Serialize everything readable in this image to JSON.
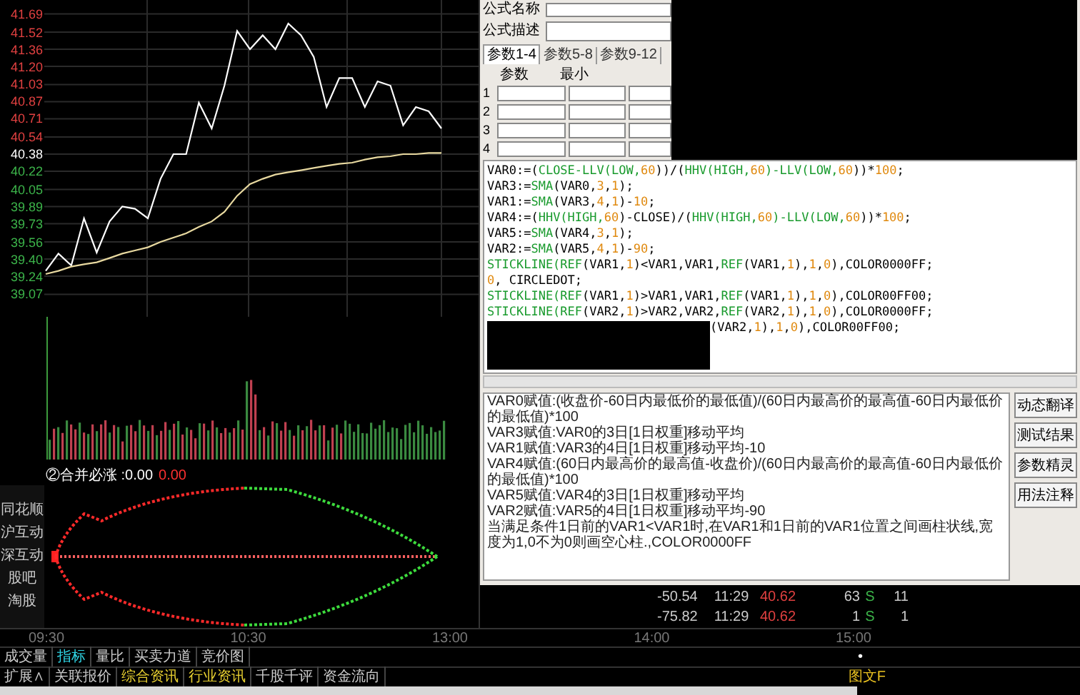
{
  "price_chart": {
    "chart_data": {
      "type": "line",
      "grid": true,
      "series": [
        {
          "color": "#ffffff",
          "values": [
            39.29,
            39.45,
            39.34,
            39.78,
            39.46,
            39.75,
            39.89,
            39.87,
            39.78,
            40.15,
            40.38,
            40.38,
            40.86,
            40.62,
            41.02,
            41.53,
            41.36,
            41.49,
            41.36,
            41.6,
            41.49,
            41.29,
            40.82,
            41.09,
            41.09,
            40.82,
            41.06,
            41.02,
            40.65,
            40.82,
            40.78,
            40.62
          ]
        },
        {
          "color": "#e8d9a0",
          "values": [
            39.26,
            39.29,
            39.33,
            39.35,
            39.37,
            39.41,
            39.45,
            39.48,
            39.51,
            39.56,
            39.6,
            39.64,
            39.7,
            39.75,
            39.84,
            39.99,
            40.1,
            40.15,
            40.19,
            40.21,
            40.23,
            40.25,
            40.27,
            40.29,
            40.3,
            40.33,
            40.35,
            40.36,
            40.38,
            40.38,
            40.39,
            40.39
          ]
        }
      ],
      "ylim": [
        38.86,
        41.82
      ],
      "yticks": [
        {
          "value": 41.69,
          "label": "41.69"
        },
        {
          "value": 41.52,
          "label": "41.52"
        },
        {
          "value": 41.36,
          "label": "41.36"
        },
        {
          "value": 41.2,
          "label": "41.20"
        },
        {
          "value": 41.03,
          "label": "41.03"
        },
        {
          "value": 40.87,
          "label": "40.87"
        },
        {
          "value": 40.71,
          "label": "40.71"
        },
        {
          "value": 40.54,
          "label": "40.54"
        },
        {
          "value": 40.38,
          "label": "40.38"
        },
        {
          "value": 40.22,
          "label": "40.22"
        },
        {
          "value": 40.05,
          "label": "40.05"
        },
        {
          "value": 39.89,
          "label": "39.89"
        },
        {
          "value": 39.73,
          "label": "39.73"
        },
        {
          "value": 39.56,
          "label": "39.56"
        },
        {
          "value": 39.4,
          "label": "39.40"
        },
        {
          "value": 39.24,
          "label": "39.24"
        },
        {
          "value": 39.07,
          "label": "39.07"
        }
      ]
    }
  },
  "indicator": {
    "title": "②合并必涨 :0.00",
    "value": "0.00"
  },
  "side_links": [
    "同花顺",
    "沪互动",
    "深互动",
    "股吧",
    "淘股"
  ],
  "time_axis": [
    "09:30",
    "10:30",
    "13:00",
    "14:00",
    "15:00"
  ],
  "chart_tabs": [
    {
      "label": "成交量",
      "selected": false
    },
    {
      "label": "指标",
      "selected": true
    },
    {
      "label": "量比",
      "selected": false
    },
    {
      "label": "买卖力道",
      "selected": false
    },
    {
      "label": "竞价图",
      "selected": false
    }
  ],
  "info_tabs": [
    {
      "label": "扩展∧",
      "highlighted": false
    },
    {
      "label": "关联报价",
      "highlighted": false
    },
    {
      "label": "综合资讯",
      "highlighted": true
    },
    {
      "label": "行业资讯",
      "highlighted": true
    },
    {
      "label": "千股千评",
      "highlighted": false
    },
    {
      "label": "资金流向",
      "highlighted": false
    }
  ],
  "side_mark": "•",
  "side_tab": "图文F",
  "quote_rows": [
    {
      "change": "-50.54",
      "time": "11:29",
      "price": "40.62",
      "volume": "63",
      "side": "S",
      "count": "11"
    },
    {
      "change": "-75.82",
      "time": "11:29",
      "price": "40.62",
      "volume": "1",
      "side": "S",
      "count": "1"
    }
  ],
  "dialog": {
    "name_label": "公式名称",
    "desc_label": "公式描述",
    "param_tabs": [
      {
        "label": "参数1-4",
        "selected": true
      },
      {
        "label": "参数5-8",
        "selected": false
      },
      {
        "label": "参数9-12",
        "selected": false
      }
    ],
    "param_headers": [
      "参数",
      "最小"
    ],
    "param_rows": [
      "1",
      "2",
      "3",
      "4"
    ],
    "code_lines": [
      [
        {
          "text": "VAR0:=(",
          "kind": "plain"
        },
        {
          "text": "CLOSE-LLV(LOW,",
          "kind": "fn"
        },
        {
          "text": "60",
          "kind": "num"
        },
        {
          "text": "))/(",
          "kind": "plain"
        },
        {
          "text": "HHV(HIGH,",
          "kind": "fn"
        },
        {
          "text": "60",
          "kind": "num"
        },
        {
          "text": ")-LLV(LOW,",
          "kind": "fn"
        },
        {
          "text": "60",
          "kind": "num"
        },
        {
          "text": "))*",
          "kind": "plain"
        },
        {
          "text": "100",
          "kind": "num"
        },
        {
          "text": ";",
          "kind": "plain"
        }
      ],
      [
        {
          "text": "VAR3:=",
          "kind": "plain"
        },
        {
          "text": "SMA",
          "kind": "fn"
        },
        {
          "text": "(VAR0,",
          "kind": "plain"
        },
        {
          "text": "3",
          "kind": "num"
        },
        {
          "text": ",",
          "kind": "plain"
        },
        {
          "text": "1",
          "kind": "num"
        },
        {
          "text": ");",
          "kind": "plain"
        }
      ],
      [
        {
          "text": "VAR1:=",
          "kind": "plain"
        },
        {
          "text": "SMA",
          "kind": "fn"
        },
        {
          "text": "(VAR3,",
          "kind": "plain"
        },
        {
          "text": "4",
          "kind": "num"
        },
        {
          "text": ",",
          "kind": "plain"
        },
        {
          "text": "1",
          "kind": "num"
        },
        {
          "text": ")-",
          "kind": "plain"
        },
        {
          "text": "10",
          "kind": "num"
        },
        {
          "text": ";",
          "kind": "plain"
        }
      ],
      [
        {
          "text": "VAR4:=(",
          "kind": "plain"
        },
        {
          "text": "HHV(HIGH,",
          "kind": "fn"
        },
        {
          "text": "60",
          "kind": "num"
        },
        {
          "text": ")-CLOSE)/(",
          "kind": "plain"
        },
        {
          "text": "HHV(HIGH,",
          "kind": "fn"
        },
        {
          "text": "60",
          "kind": "num"
        },
        {
          "text": ")-LLV(LOW,",
          "kind": "fn"
        },
        {
          "text": "60",
          "kind": "num"
        },
        {
          "text": "))*",
          "kind": "plain"
        },
        {
          "text": "100",
          "kind": "num"
        },
        {
          "text": ";",
          "kind": "plain"
        }
      ],
      [
        {
          "text": "VAR5:=",
          "kind": "plain"
        },
        {
          "text": "SMA",
          "kind": "fn"
        },
        {
          "text": "(VAR4,",
          "kind": "plain"
        },
        {
          "text": "3",
          "kind": "num"
        },
        {
          "text": ",",
          "kind": "plain"
        },
        {
          "text": "1",
          "kind": "num"
        },
        {
          "text": ");",
          "kind": "plain"
        }
      ],
      [
        {
          "text": "VAR2:=",
          "kind": "plain"
        },
        {
          "text": "SMA",
          "kind": "fn"
        },
        {
          "text": "(VAR5,",
          "kind": "plain"
        },
        {
          "text": "4",
          "kind": "num"
        },
        {
          "text": ",",
          "kind": "plain"
        },
        {
          "text": "1",
          "kind": "num"
        },
        {
          "text": ")-",
          "kind": "plain"
        },
        {
          "text": "90",
          "kind": "num"
        },
        {
          "text": ";",
          "kind": "plain"
        }
      ],
      [
        {
          "text": "STICKLINE(REF",
          "kind": "fn"
        },
        {
          "text": "(VAR1,",
          "kind": "plain"
        },
        {
          "text": "1",
          "kind": "num"
        },
        {
          "text": ")<VAR1,VAR1,",
          "kind": "plain"
        },
        {
          "text": "REF",
          "kind": "fn"
        },
        {
          "text": "(VAR1,",
          "kind": "plain"
        },
        {
          "text": "1",
          "kind": "num"
        },
        {
          "text": "),",
          "kind": "plain"
        },
        {
          "text": "1",
          "kind": "num"
        },
        {
          "text": ",",
          "kind": "plain"
        },
        {
          "text": "0",
          "kind": "num"
        },
        {
          "text": "),COLOR0000FF;",
          "kind": "plain"
        }
      ],
      [
        {
          "text": "0",
          "kind": "num"
        },
        {
          "text": ", CIRCLEDOT;",
          "kind": "plain"
        }
      ],
      [
        {
          "text": "STICKLINE(REF",
          "kind": "fn"
        },
        {
          "text": "(VAR1,",
          "kind": "plain"
        },
        {
          "text": "1",
          "kind": "num"
        },
        {
          "text": ")>VAR1,VAR1,",
          "kind": "plain"
        },
        {
          "text": "REF",
          "kind": "fn"
        },
        {
          "text": "(VAR1,",
          "kind": "plain"
        },
        {
          "text": "1",
          "kind": "num"
        },
        {
          "text": "),",
          "kind": "plain"
        },
        {
          "text": "1",
          "kind": "num"
        },
        {
          "text": ",",
          "kind": "plain"
        },
        {
          "text": "0",
          "kind": "num"
        },
        {
          "text": "),COLOR00FF00;",
          "kind": "plain"
        }
      ],
      [
        {
          "text": "STICKLINE(REF",
          "kind": "fn"
        },
        {
          "text": "(VAR2,",
          "kind": "plain"
        },
        {
          "text": "1",
          "kind": "num"
        },
        {
          "text": ")>VAR2,VAR2,",
          "kind": "plain"
        },
        {
          "text": "REF",
          "kind": "fn"
        },
        {
          "text": "(VAR2,",
          "kind": "plain"
        },
        {
          "text": "1",
          "kind": "num"
        },
        {
          "text": "),",
          "kind": "plain"
        },
        {
          "text": "1",
          "kind": "num"
        },
        {
          "text": ",",
          "kind": "plain"
        },
        {
          "text": "0",
          "kind": "num"
        },
        {
          "text": "),COLOR0000FF;",
          "kind": "plain"
        }
      ]
    ],
    "code_fragment": [
      {
        "text": "(VAR2,",
        "kind": "plain"
      },
      {
        "text": "1",
        "kind": "num"
      },
      {
        "text": "),",
        "kind": "plain"
      },
      {
        "text": "1",
        "kind": "num"
      },
      {
        "text": ",",
        "kind": "plain"
      },
      {
        "text": "0",
        "kind": "num"
      },
      {
        "text": "),COLOR00FF00;",
        "kind": "plain"
      }
    ],
    "translation": [
      "VAR0赋值:(收盘价-60日内最低价的最低值)/(60日内最高价的最高值-60日内最低价的最低值)*100",
      "VAR3赋值:VAR0的3日[1日权重]移动平均",
      "VAR1赋值:VAR3的4日[1日权重]移动平均-10",
      "VAR4赋值:(60日内最高价的最高值-收盘价)/(60日内最高价的最高值-60日内最低价的最低值)*100",
      "VAR5赋值:VAR4的3日[1日权重]移动平均",
      "VAR2赋值:VAR5的4日[1日权重]移动平均-90",
      "当满足条件1日前的VAR1<VAR1时,在VAR1和1日前的VAR1位置之间画柱状线,宽度为1,0不为0则画空心柱.,COLOR0000FF"
    ],
    "buttons": [
      "动态翻译",
      "测试结果",
      "参数精灵",
      "用法注释"
    ]
  }
}
